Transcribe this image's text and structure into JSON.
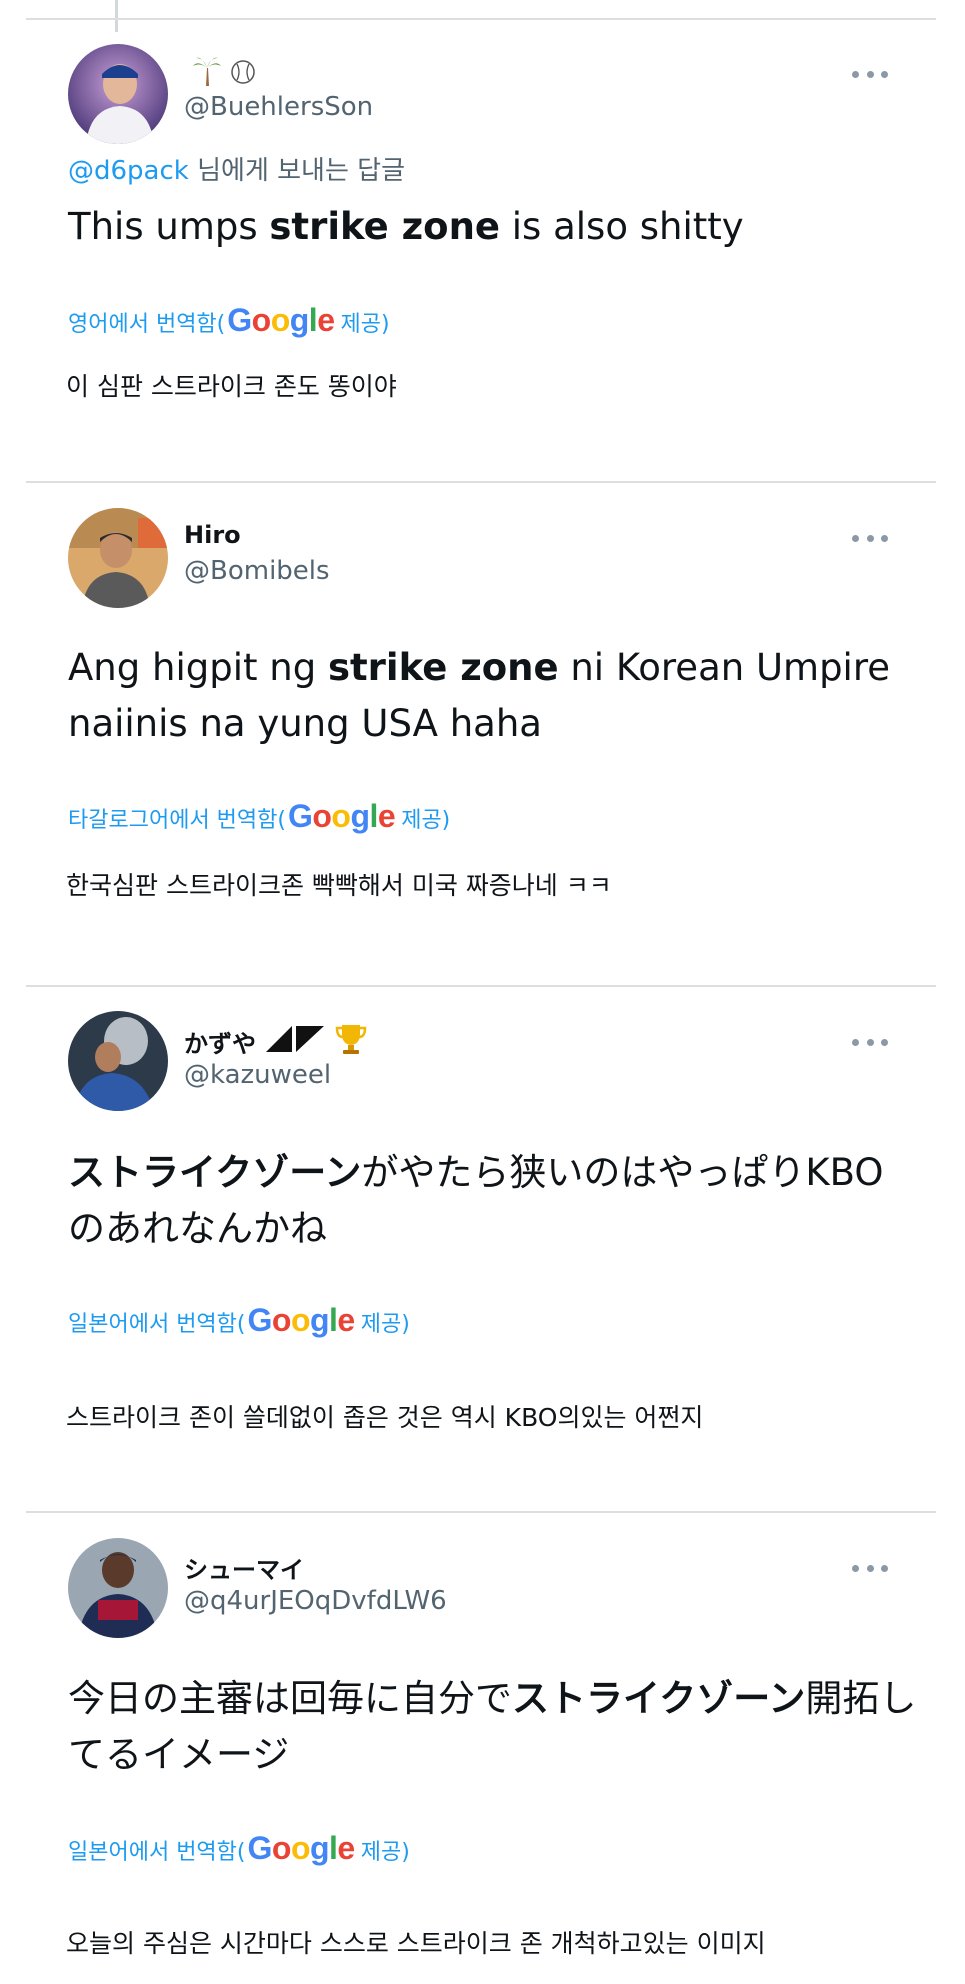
{
  "tweets": [
    {
      "display_name": "",
      "name_icons": [
        "palm-tree-icon",
        "baseball-icon"
      ],
      "handle": "@BuehlersSon",
      "reply_prefix_mention": "@d6pack",
      "reply_suffix": " 님에게 보내는 답글",
      "body_parts": [
        "This umps ",
        "strike zone",
        " is also shitty"
      ],
      "translated_prefix": "영어에서 번역함(",
      "translated_suffix": "제공)",
      "translation": "이 심판 스트라이크 존도 똥이야"
    },
    {
      "display_name": "Hiro",
      "handle": "@Bomibels",
      "body_parts": [
        "Ang higpit ng ",
        "strike zone",
        " ni Korean Umpire naiinis na yung USA haha"
      ],
      "translated_prefix": "타갈로그어에서 번역함(",
      "translated_suffix": "제공)",
      "translation": "한국심판 스트라이크존 빡빡해서 미국 짜증나네 ㅋㅋ"
    },
    {
      "display_name": "かずや",
      "name_icons": [
        "flag-icon",
        "trophy-icon"
      ],
      "handle": "@kazuweel",
      "body_parts": [
        "ストライクゾーン",
        "がやたら狭いのはやっぱりKBOのあれなんかね"
      ],
      "translated_prefix": "일본어에서 번역함(",
      "translated_suffix": "제공)",
      "translation": "스트라이크 존이 쓸데없이 좁은 것은 역시 KBO의있는 어쩐지"
    },
    {
      "display_name": "シューマイ",
      "handle": "@q4urJEOqDvfdLW6",
      "body_parts": [
        "今日の主審は回毎に自分で",
        "ストライクゾーン",
        "開拓してるイメージ"
      ],
      "translated_prefix": "일본어에서 번역함(",
      "translated_suffix": "제공)",
      "translation": "오늘의 주심은 시간마다 스스로 스트라이크 존 개척하고있는 이미지"
    }
  ],
  "google_logo": [
    "G",
    "o",
    "o",
    "g",
    "l",
    "e"
  ],
  "colors": {
    "link": "#1d9bf0",
    "secondary_text": "#536471",
    "divider": "#dedede",
    "google_blue": "#4285f4",
    "google_red": "#ea4335",
    "google_yellow": "#fbbc05",
    "google_green": "#34a853"
  }
}
